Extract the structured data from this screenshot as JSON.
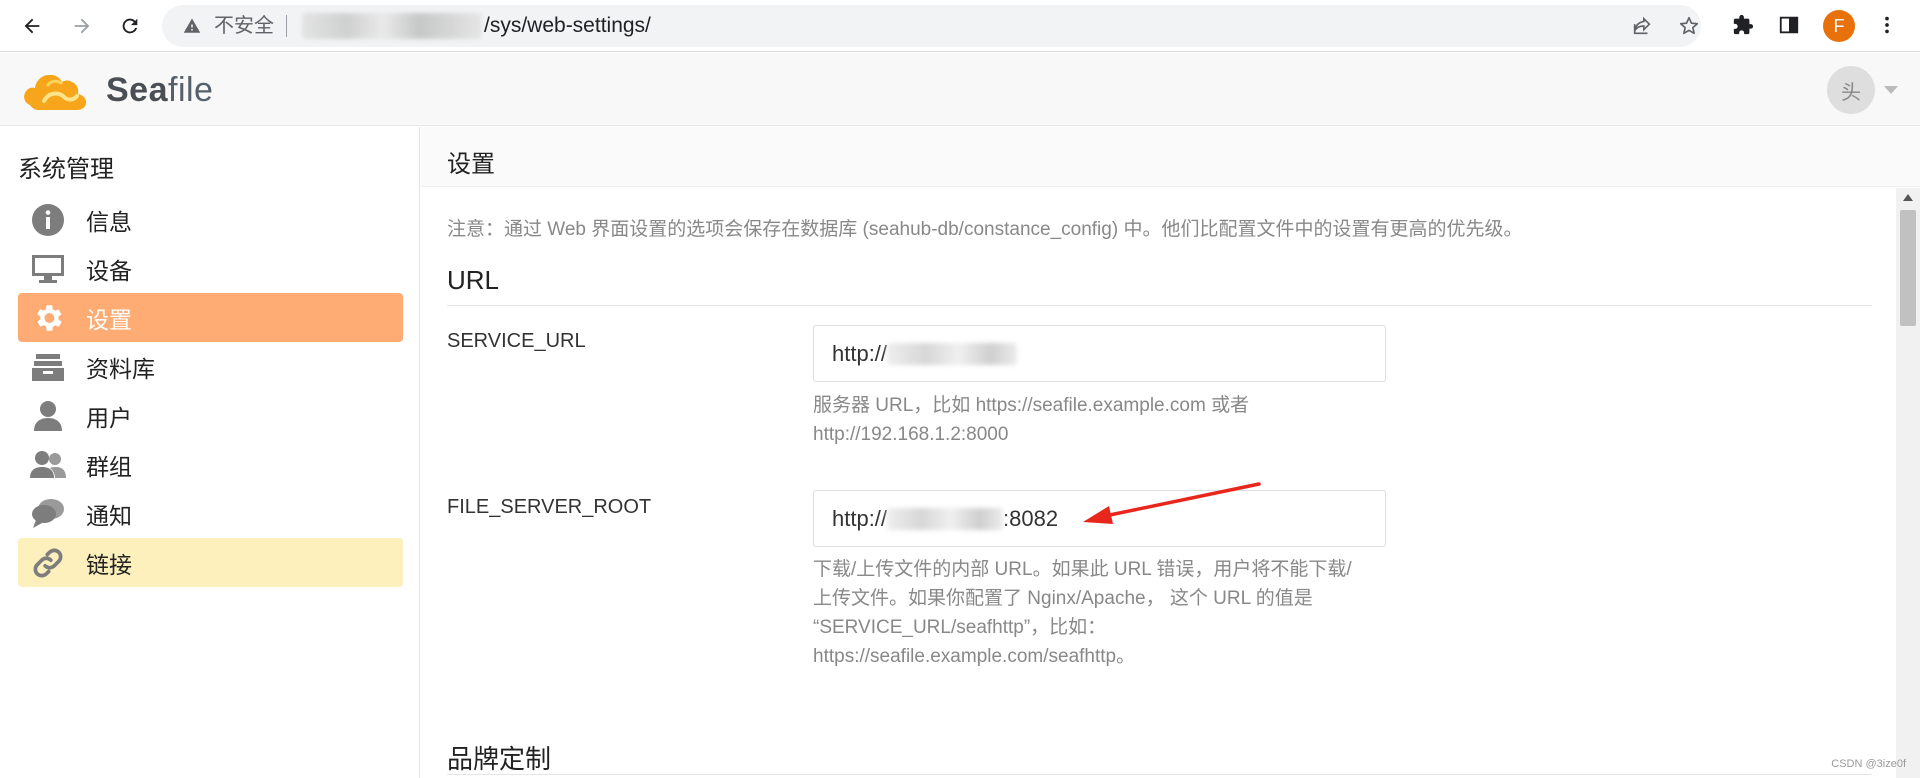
{
  "browser": {
    "security_label": "不安全",
    "url_path": "/sys/web-settings/",
    "profile_initial": "F"
  },
  "app": {
    "logo_text_bold": "Sea",
    "logo_text_rest": "file",
    "avatar_alt": "头"
  },
  "sidebar": {
    "heading": "系统管理",
    "items": [
      {
        "label": "信息",
        "icon": "info-icon"
      },
      {
        "label": "设备",
        "icon": "monitor-icon"
      },
      {
        "label": "设置",
        "icon": "gear-icon",
        "state": "active"
      },
      {
        "label": "资料库",
        "icon": "library-icon"
      },
      {
        "label": "用户",
        "icon": "user-icon"
      },
      {
        "label": "群组",
        "icon": "group-icon"
      },
      {
        "label": "通知",
        "icon": "chat-icon"
      },
      {
        "label": "链接",
        "icon": "link-icon",
        "state": "hover"
      }
    ]
  },
  "main": {
    "title": "设置",
    "notice": "注意：通过 Web 界面设置的选项会保存在数据库 (seahub-db/constance_config) 中。他们比配置文件中的设置有更高的优先级。",
    "url_section": {
      "title": "URL",
      "fields": [
        {
          "label": "SERVICE_URL",
          "value_prefix": "http://",
          "value_suffix": "",
          "help": [
            "服务器 URL，比如 https://seafile.example.com 或者",
            "http://192.168.1.2:8000"
          ]
        },
        {
          "label": "FILE_SERVER_ROOT",
          "value_prefix": "http://",
          "value_suffix": ":8082",
          "help": [
            "下载/上传文件的内部 URL。如果此 URL 错误，用户将不能下载/",
            "上传文件。如果你配置了 Nginx/Apache， 这个 URL 的值是",
            "“SERVICE_URL/seafhttp”，比如：",
            "https://seafile.example.com/seafhttp。"
          ]
        }
      ]
    },
    "brand_section": {
      "title": "品牌定制"
    }
  },
  "colors": {
    "active_bg": "#feac74",
    "hover_bg": "#fdf0bd",
    "logo_orange": "#f7a51a",
    "annotation_red": "#e8261c"
  },
  "watermark": "CSDN @3ize0f"
}
